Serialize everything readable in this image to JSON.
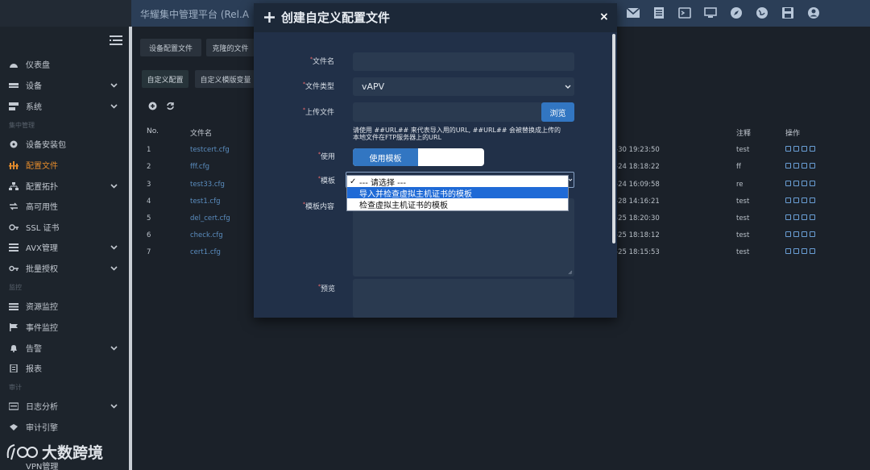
{
  "header": {
    "app_title": "华耀集中管理平台 (Rel.A",
    "icons": [
      "mail-icon",
      "document-icon",
      "terminal-icon",
      "monitor-icon",
      "compass-icon",
      "globe-icon",
      "save-icon",
      "user-icon"
    ]
  },
  "sidebar": {
    "items": [
      {
        "label": "仪表盘",
        "icon": "dashboard-icon",
        "chevron": false
      },
      {
        "label": "设备",
        "icon": "device-icon",
        "chevron": true
      },
      {
        "label": "系统",
        "icon": "system-icon",
        "chevron": true
      },
      {
        "label": "设备安装包",
        "icon": "package-icon",
        "chevron": false
      },
      {
        "label": "配置文件",
        "icon": "config-file-icon",
        "chevron": false,
        "active": true
      },
      {
        "label": "配置拓扑",
        "icon": "topology-icon",
        "chevron": true
      },
      {
        "label": "高可用性",
        "icon": "ha-icon",
        "chevron": false
      },
      {
        "label": "SSL 证书",
        "icon": "ssl-icon",
        "chevron": false
      },
      {
        "label": "AVX管理",
        "icon": "avx-icon",
        "chevron": true
      },
      {
        "label": "批量授权",
        "icon": "key-icon",
        "chevron": true
      },
      {
        "label": "资源监控",
        "icon": "monitor-list-icon",
        "chevron": false
      },
      {
        "label": "事件监控",
        "icon": "flag-icon",
        "chevron": false
      },
      {
        "label": "告警",
        "icon": "bell-icon",
        "chevron": true
      },
      {
        "label": "报表",
        "icon": "report-icon",
        "chevron": false
      },
      {
        "label": "日志分析",
        "icon": "log-icon",
        "chevron": true
      },
      {
        "label": "审计引擎",
        "icon": "audit-icon",
        "chevron": false
      },
      {
        "label": "VPN管理",
        "icon": "vpn-icon",
        "chevron": false
      }
    ],
    "sections": {
      "central": "集中管理",
      "monitor": "监控",
      "audit": "审计"
    }
  },
  "main": {
    "tabs_row1": [
      "设备配置文件",
      "克隆的文件"
    ],
    "tabs_row2": [
      "自定义配置",
      "自定义模版变量"
    ],
    "columns": {
      "no": "No.",
      "filename": "文件名",
      "note": "注释",
      "action": "操作"
    },
    "rows": [
      {
        "no": "1",
        "name": "testcert.cfg",
        "time": "-30 19:23:50",
        "note": "test"
      },
      {
        "no": "2",
        "name": "fff.cfg",
        "time": "-24 18:18:22",
        "note": "ff"
      },
      {
        "no": "3",
        "name": "test33.cfg",
        "time": "-24 16:09:58",
        "note": "re"
      },
      {
        "no": "4",
        "name": "test1.cfg",
        "time": "-28 14:16:21",
        "note": "test"
      },
      {
        "no": "5",
        "name": "del_cert.cfg",
        "time": "-25 18:20:30",
        "note": "test"
      },
      {
        "no": "6",
        "name": "check.cfg",
        "time": "-25 18:18:12",
        "note": "test"
      },
      {
        "no": "7",
        "name": "cert1.cfg",
        "time": "-25 18:15:53",
        "note": "test"
      }
    ]
  },
  "modal": {
    "title": "创建自定义配置文件",
    "close": "×",
    "fields": {
      "filename_label": "文件名",
      "filename_value": "",
      "filetype_label": "文件类型",
      "filetype_value": "vAPV",
      "upload_label": "上传文件",
      "browse_button": "浏览",
      "hint_line1": "请使用 ##URL## 来代表导入用的URL, ##URL## 会被替换成上传的",
      "hint_line2": "本地文件在FTP服务器上的URL",
      "use_label": "使用",
      "use_template_button": "使用模板",
      "template_label": "模板",
      "template_content_label": "模板内容",
      "preview_label": "预览",
      "required_mark": "*"
    },
    "template_options": [
      "--- 请选择 ---",
      "导入并检查虚拟主机证书的模板",
      "检查虚拟主机证书的模板"
    ],
    "template_selected_index": 0,
    "template_highlight_index": 1
  },
  "watermark": {
    "text": "大数跨境"
  }
}
